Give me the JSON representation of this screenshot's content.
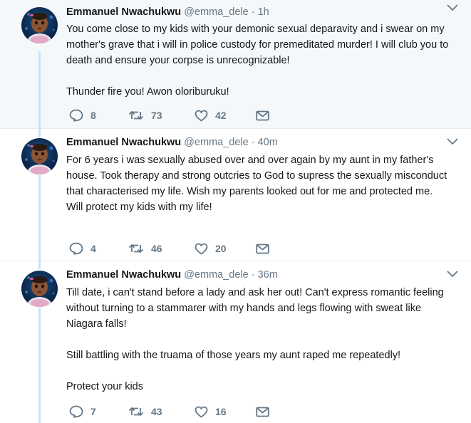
{
  "tweets": [
    {
      "name": "Emmanuel Nwachukwu",
      "handle": "@emma_dele",
      "separator": "·",
      "time": "1h",
      "paragraphs": [
        "You come close to my kids with your demonic sexual deparavity and i swear on my mother's grave that i will in police custody for premeditated murder! I will club you to death and ensure your corpse is unrecognizable!",
        "Thunder fire you! Awon oloriburuku!"
      ],
      "replies": "8",
      "retweets": "73",
      "likes": "42"
    },
    {
      "name": "Emmanuel Nwachukwu",
      "handle": "@emma_dele",
      "separator": "·",
      "time": "40m",
      "paragraphs": [
        "For 6 years i was sexually abused over and over again by my aunt in my father's house. Took therapy and strong outcries to God to supress the sexually misconduct that characterised my life. Wish my parents looked out for me and protected me.",
        "Will protect my kids with my life!"
      ],
      "replies": "4",
      "retweets": "46",
      "likes": "20"
    },
    {
      "name": "Emmanuel Nwachukwu",
      "handle": "@emma_dele",
      "separator": "·",
      "time": "36m",
      "paragraphs": [
        "Till date, i can't stand before a lady and ask her out! Can't express romantic feeling without turning to a stammarer with my hands and legs flowing with sweat like Niagara falls!",
        "Still battling with the truama of those years my aunt raped me repeatedly!",
        "Protect your kids"
      ],
      "replies": "7",
      "retweets": "43",
      "likes": "16"
    }
  ],
  "icons": {
    "reply": "reply-icon",
    "retweet": "retweet-icon",
    "like": "heart-icon",
    "message": "envelope-icon",
    "menu": "chevron-down-icon"
  },
  "colors": {
    "highlight_background": "#f5f8fa",
    "secondary_text": "#657786",
    "thread_line": "#c4e4f7"
  }
}
